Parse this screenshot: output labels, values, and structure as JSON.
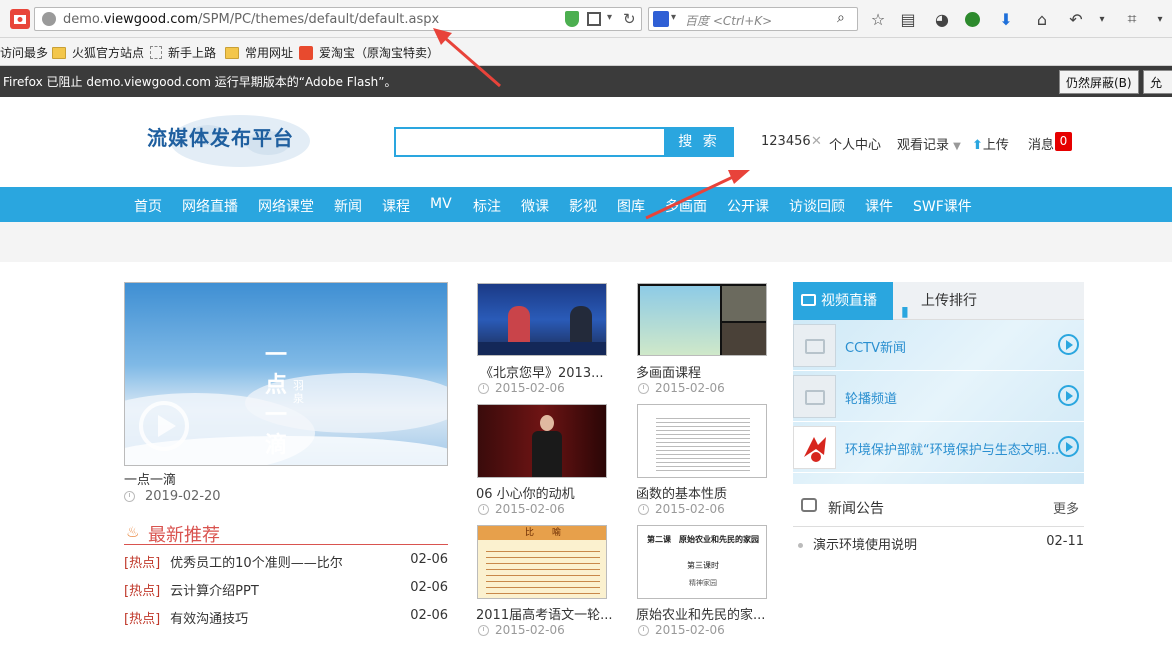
{
  "browser": {
    "url_prefix": "demo.",
    "url_domain": "viewgood.com",
    "url_path": "/SPM/PC/themes/default/default.aspx",
    "search_engine": "百度",
    "search_placeholder": "<Ctrl+K>",
    "bookmarks": [
      "访问最多",
      "火狐官方站点",
      "新手上路",
      "常用网址",
      "爱淘宝（原淘宝特卖）"
    ],
    "flash_notice": "Firefox 已阻止 demo.viewgood.com 运行早期版本的“Adobe Flash”。",
    "flash_btn_block": "仍然屏蔽(B)",
    "flash_btn_allow": "允"
  },
  "header": {
    "logo": "流媒体发布平台",
    "search_button": "搜 索",
    "user": "123456",
    "close_mark": "✕",
    "personal": "个人中心",
    "history": "观看记录",
    "upload": "上传",
    "messages": "消息",
    "message_count": "0"
  },
  "nav": [
    "首页",
    "网络直播",
    "网络课堂",
    "新闻",
    "课程",
    "MV",
    "标注",
    "微课",
    "影视",
    "图库",
    "多画面",
    "公开课",
    "访谈回顾",
    "课件",
    "SWF课件"
  ],
  "featured": {
    "title": "一点一滴",
    "date": "2019-02-20",
    "overlay_text": "一点一滴",
    "overlay_sub": "羽泉"
  },
  "videos": [
    {
      "title": "《北京您早》2013...",
      "date": "2015-02-06"
    },
    {
      "title": "多画面课程",
      "date": "2015-02-06"
    },
    {
      "title": "06 小心你的动机",
      "date": "2015-02-06"
    },
    {
      "title": "函数的基本性质",
      "date": "2015-02-06"
    },
    {
      "title": "2011届高考语文一轮...",
      "date": "2015-02-06"
    },
    {
      "title": "原始农业和先民的家...",
      "date": "2015-02-06"
    }
  ],
  "thumb_text": {
    "slide_title": "比　　喻",
    "lesson_title": "第二课　原始农业和先民的家园",
    "lesson_sub": "第三课时",
    "lesson_sub2": "精神家园"
  },
  "recommend": {
    "heading": "最新推荐",
    "items": [
      {
        "tag": "[热点]",
        "title": "优秀员工的10个准则——比尔",
        "date": "02-06"
      },
      {
        "tag": "[热点]",
        "title": "云计算介绍PPT",
        "date": "02-06"
      },
      {
        "tag": "[热点]",
        "title": "有效沟通技巧",
        "date": "02-06"
      }
    ]
  },
  "right": {
    "tab_live": "视频直播",
    "tab_rank": "上传排行",
    "channels": [
      "CCTV新闻",
      "轮播频道",
      "环境保护部就“环境保护与生态文明..."
    ],
    "news_heading": "新闻公告",
    "news_more": "更多",
    "news_items": [
      {
        "title": "演示环境使用说明",
        "date": "02-11"
      }
    ]
  },
  "colors": {
    "accent": "#2aa6df",
    "logo": "#1f5f9f",
    "hot": "#c0392b",
    "badge": "#e60000"
  }
}
